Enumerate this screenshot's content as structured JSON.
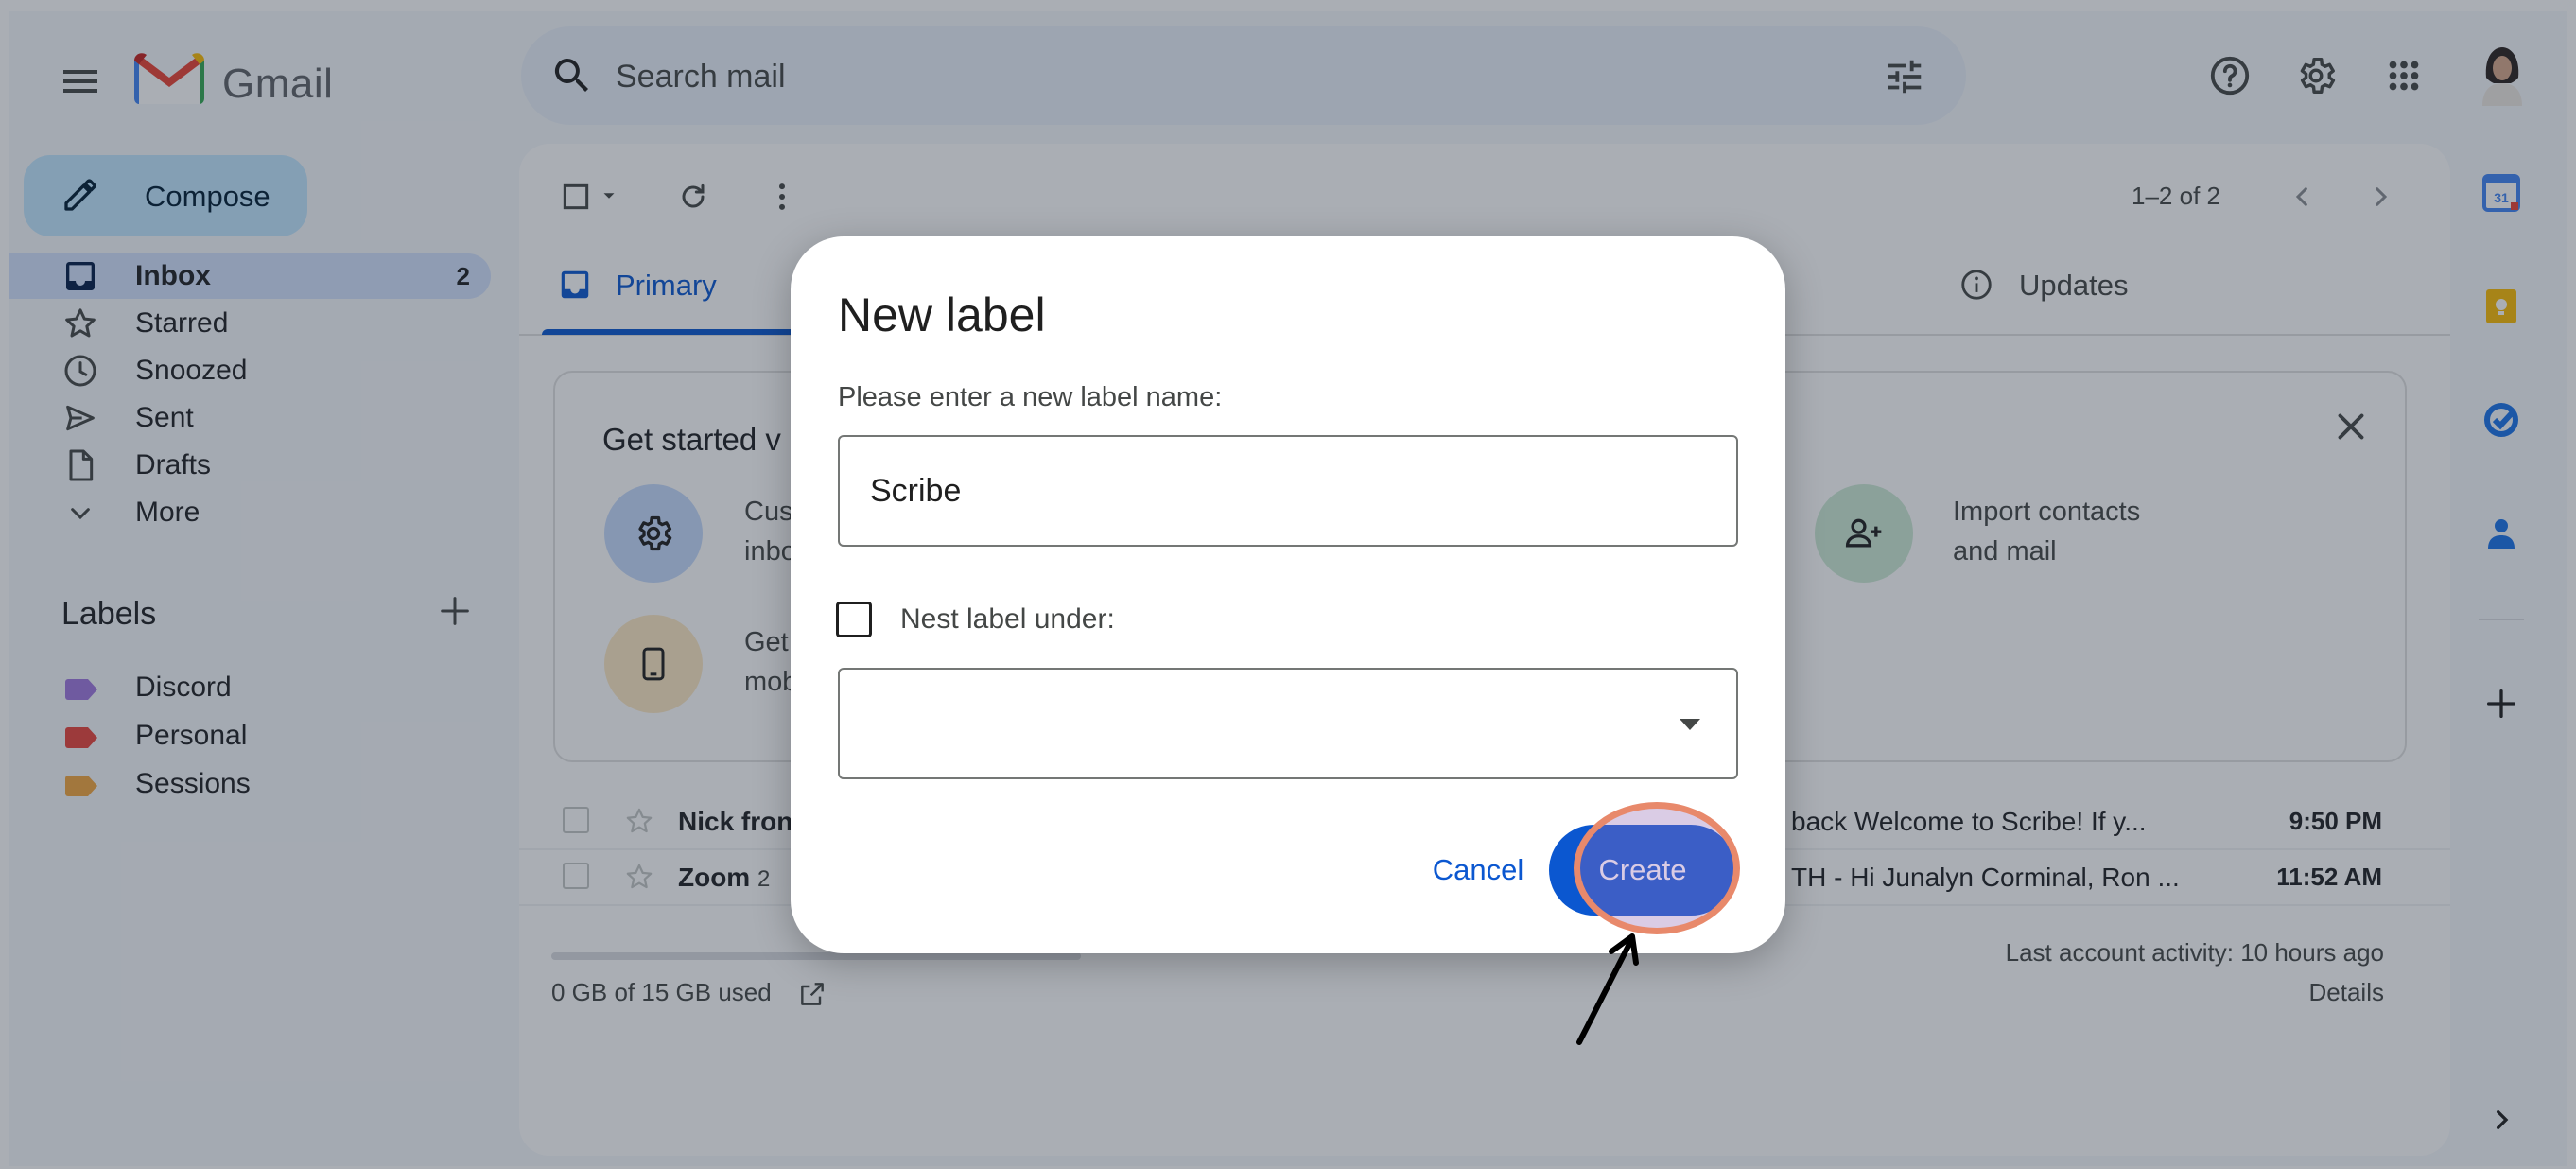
{
  "app": {
    "name": "Gmail"
  },
  "search": {
    "placeholder": "Search mail"
  },
  "sidebar": {
    "compose_label": "Compose",
    "items": [
      {
        "label": "Inbox",
        "count": "2",
        "icon": "inbox-icon"
      },
      {
        "label": "Starred",
        "icon": "star-icon"
      },
      {
        "label": "Snoozed",
        "icon": "clock-icon"
      },
      {
        "label": "Sent",
        "icon": "send-icon"
      },
      {
        "label": "Drafts",
        "icon": "draft-icon"
      },
      {
        "label": "More",
        "icon": "chevron-down-icon"
      }
    ],
    "labels_heading": "Labels",
    "labels": [
      {
        "label": "Discord",
        "color": "#a178df"
      },
      {
        "label": "Personal",
        "color": "#e8453c"
      },
      {
        "label": "Sessions",
        "color": "#f2a640"
      }
    ]
  },
  "toolbar": {
    "pager": "1–2 of 2"
  },
  "tabs": [
    {
      "label": "Primary",
      "active": true
    },
    {
      "label": "Updates",
      "active": false
    }
  ],
  "getting_started": {
    "title_partial": "Get started v",
    "items": [
      {
        "text_line1": "Cus",
        "text_line2": "inbo",
        "icon": "gear-icon",
        "color": "#c6dafc"
      },
      {
        "text_line1": "Get",
        "text_line2": "mob",
        "icon": "phone-icon",
        "color": "#fde9c4"
      },
      {
        "text_line1": "Import contacts",
        "text_line2": "and mail",
        "icon": "add-contact-icon",
        "color": "#ceead6"
      }
    ]
  },
  "emails": [
    {
      "sender": "Nick fron",
      "count": "",
      "subject": "back   Welcome to Scribe! If y...",
      "time": "9:50 PM"
    },
    {
      "sender": "Zoom",
      "count": "2",
      "subject": "TH - Hi Junalyn Corminal, Ron ...",
      "time": "11:52 AM"
    }
  ],
  "footer": {
    "storage_text": "0 GB of 15 GB used",
    "storage_used_fraction": 0,
    "last_activity": "Last account activity: 10 hours ago",
    "details": "Details"
  },
  "dialog": {
    "title": "New label",
    "prompt": "Please enter a new label name:",
    "name_value": "Scribe",
    "nest_label": "Nest label under:",
    "nest_checked": false,
    "cancel_label": "Cancel",
    "create_label": "Create"
  }
}
